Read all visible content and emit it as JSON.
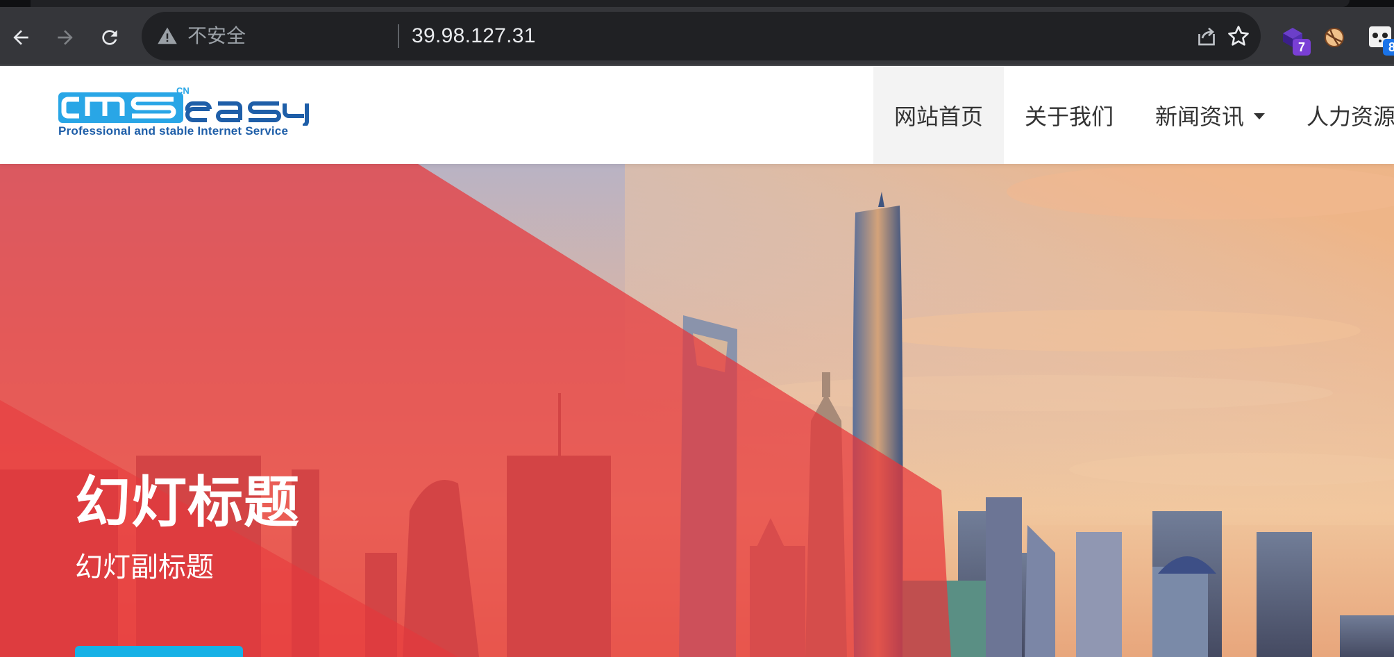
{
  "browser": {
    "security_label": "不安全",
    "url": "39.98.127.31",
    "extensions": [
      {
        "name": "extension-1",
        "badge": "7",
        "badge_color": "#7a3fd6"
      },
      {
        "name": "extension-2",
        "badge": "",
        "badge_color": ""
      },
      {
        "name": "extension-3",
        "badge": "8",
        "badge_color": "#1a73e8"
      }
    ],
    "icons": {
      "back": "arrow-left-icon",
      "forward": "arrow-right-icon",
      "reload": "reload-icon",
      "security": "warning-triangle-icon",
      "share": "share-icon",
      "bookmark": "star-icon"
    }
  },
  "site": {
    "logo": {
      "wordmark": "cmseasy",
      "superscript": "CN",
      "tagline": "Professional and stable Internet Service"
    },
    "nav": [
      {
        "label": "网站首页",
        "active": true,
        "has_dropdown": false
      },
      {
        "label": "关于我们",
        "active": false,
        "has_dropdown": false
      },
      {
        "label": "新闻资讯",
        "active": false,
        "has_dropdown": true
      },
      {
        "label": "人力资源",
        "active": false,
        "has_dropdown": false
      }
    ]
  },
  "hero": {
    "title": "幻灯标题",
    "subtitle": "幻灯副标题",
    "accent_color": "#e8363a",
    "button_color": "#16b1e6"
  }
}
